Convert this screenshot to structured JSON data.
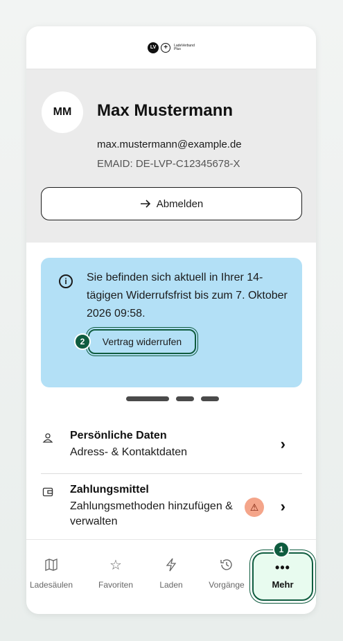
{
  "logo": {
    "mark": "LV",
    "text": "LadeVerbund Plus"
  },
  "profile": {
    "initials": "MM",
    "name": "Max Mustermann",
    "email": "max.mustermann@example.de",
    "emaid": "EMAID: DE-LVP-C12345678-X",
    "logout_label": "Abmelden"
  },
  "info_card": {
    "text": "Sie befinden sich aktuell in Ihrer 14-tägigen Widerrufsfrist bis zum 7. Oktober 2026 09:58.",
    "button_label": "Vertrag widerrufen",
    "badge": "2"
  },
  "menu": [
    {
      "title": "Persönliche Daten",
      "subtitle": "Adress- & Kontaktdaten",
      "icon": "person-icon"
    },
    {
      "title": "Zahlungsmittel",
      "subtitle": "Zahlungsmethoden hinzufügen & verwalten",
      "icon": "wallet-icon",
      "warning": true
    }
  ],
  "tabs": [
    {
      "label": "Ladesäulen",
      "icon": "map-icon"
    },
    {
      "label": "Favoriten",
      "icon": "star-icon"
    },
    {
      "label": "Laden",
      "icon": "lightning-icon"
    },
    {
      "label": "Vorgänge",
      "icon": "history-icon"
    },
    {
      "label": "Mehr",
      "icon": "more-icon",
      "active": true,
      "badge": "1"
    }
  ],
  "colors": {
    "accent": "#0f5c3f",
    "info_bg": "#b3e0f6",
    "warning": "#f4a58a",
    "profile_bg": "#ebebeb"
  }
}
